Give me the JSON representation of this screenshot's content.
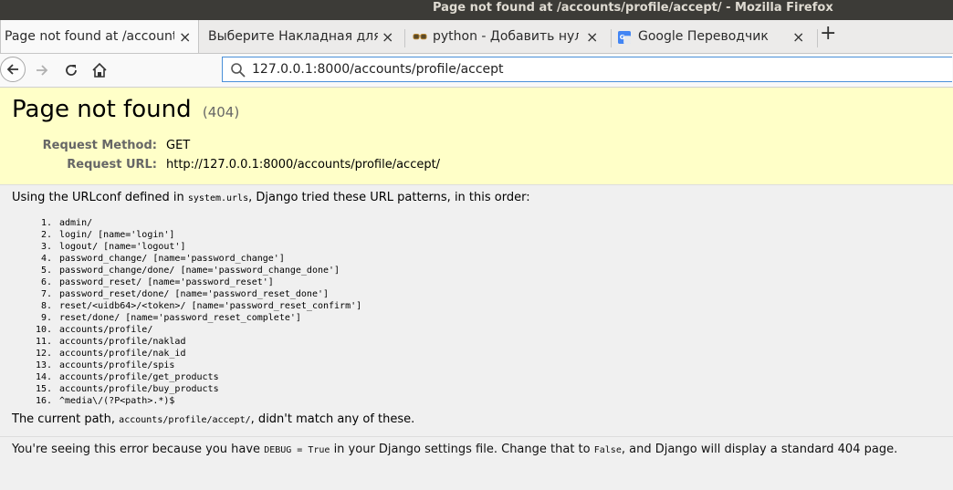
{
  "window": {
    "title": "Page not found at /accounts/profile/accept/ - Mozilla Firefox"
  },
  "tabs": [
    {
      "label": "Page not found at /accounts",
      "active": true
    },
    {
      "label": "Выберите Накладная для и",
      "active": false
    },
    {
      "label": "python - Добавить нули",
      "active": false
    },
    {
      "label": "Google Переводчик",
      "active": false
    }
  ],
  "close_glyph": "×",
  "newtab_glyph": "+",
  "nav": {
    "url": "127.0.0.1:8000/accounts/profile/accept"
  },
  "summary": {
    "title": "Page not found",
    "code": "(404)",
    "request_method_label": "Request Method:",
    "request_method": "GET",
    "request_url_label": "Request URL:",
    "request_url": "http://127.0.0.1:8000/accounts/profile/accept/"
  },
  "info": {
    "pre": "Using the URLconf defined in ",
    "module": "system.urls",
    "post": ", Django tried these URL patterns, in this order:"
  },
  "patterns": [
    {
      "num": "1.",
      "text": "admin/"
    },
    {
      "num": "2.",
      "text": "login/ [name='login']"
    },
    {
      "num": "3.",
      "text": "logout/ [name='logout']"
    },
    {
      "num": "4.",
      "text": "password_change/ [name='password_change']"
    },
    {
      "num": "5.",
      "text": "password_change/done/ [name='password_change_done']"
    },
    {
      "num": "6.",
      "text": "password_reset/ [name='password_reset']"
    },
    {
      "num": "7.",
      "text": "password_reset/done/ [name='password_reset_done']"
    },
    {
      "num": "8.",
      "text": "reset/<uidb64>/<token>/ [name='password_reset_confirm']"
    },
    {
      "num": "9.",
      "text": "reset/done/ [name='password_reset_complete']"
    },
    {
      "num": "10.",
      "text": "accounts/profile/"
    },
    {
      "num": "11.",
      "text": "accounts/profile/naklad"
    },
    {
      "num": "12.",
      "text": "accounts/profile/nak_id"
    },
    {
      "num": "13.",
      "text": "accounts/profile/spis"
    },
    {
      "num": "14.",
      "text": "accounts/profile/get_products"
    },
    {
      "num": "15.",
      "text": "accounts/profile/buy_products"
    },
    {
      "num": "16.",
      "text": "^media\\/(?P<path>.*)$"
    }
  ],
  "current": {
    "pre": "The current path, ",
    "path": "accounts/profile/accept/",
    "post": ", didn't match any of these."
  },
  "explanation": {
    "pre": "You're seeing this error because you have ",
    "debug": "DEBUG = True",
    "mid": " in your Django settings file. Change that to ",
    "false": "False",
    "post": ", and Django will display a standard 404 page."
  }
}
